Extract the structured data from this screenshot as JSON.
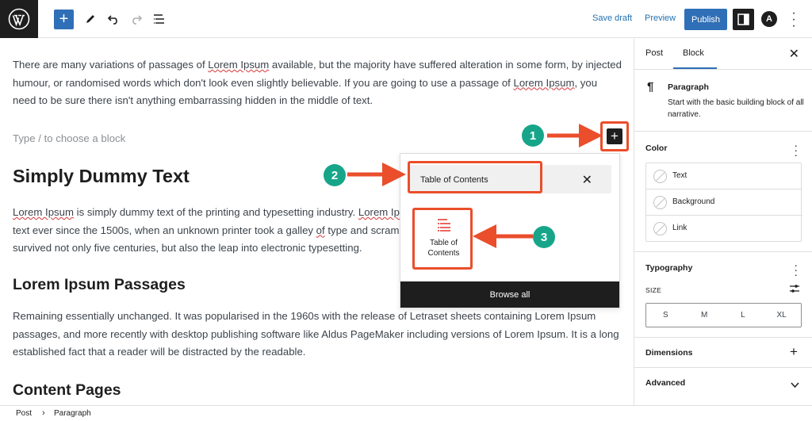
{
  "toolbar": {
    "save_draft": "Save draft",
    "preview": "Preview",
    "publish": "Publish",
    "astra_letter": "A"
  },
  "content": {
    "para1_parts": [
      "There are many variations of passages of ",
      "Lorem Ipsum",
      " available, but the majority have suffered alteration in some form, by injected humour, or randomised words which don't look even slightly believable. If you are going to use a passage of ",
      "Lorem Ipsum",
      ", you need to be sure there isn't anything embarrassing hidden in the middle of text."
    ],
    "placeholder": "Type / to choose a block",
    "heading1": "Simply Dummy Text",
    "para2_parts": [
      "Lorem Ipsum",
      " is simply dummy text of the printing and typesetting industry. ",
      "Lorem Ip",
      "...",
      "text ever since the 1500s, when an unknown printer took a galley ",
      "of",
      " type and scramb",
      "survived not only five centuries, but also the leap into electronic typesetting."
    ],
    "heading2": "Lorem Ipsum Passages",
    "para3": "Remaining essentially unchanged. It was popularised in the 1960s with the release of Letraset sheets containing Lorem Ipsum passages, and more recently with desktop publishing software like Aldus PageMaker including versions of Lorem Ipsum. It is a long established fact that a reader will be distracted by the readable.",
    "heading3": "Content Pages"
  },
  "inserter": {
    "search_value": "Table of Contents",
    "result_label_line1": "Table of",
    "result_label_line2": "Contents",
    "browse_all": "Browse all"
  },
  "annotations": {
    "badge1": "1",
    "badge2": "2",
    "badge3": "3",
    "color": "#ea4e2b",
    "badge_color": "#17a58a"
  },
  "sidebar": {
    "tab_post": "Post",
    "tab_block": "Block",
    "block_name": "Paragraph",
    "block_desc": "Start with the basic building block of all narrative.",
    "color_title": "Color",
    "color_items": [
      "Text",
      "Background",
      "Link"
    ],
    "typography_title": "Typography",
    "size_label": "SIZE",
    "sizes": [
      "S",
      "M",
      "L",
      "XL"
    ],
    "dimensions_title": "Dimensions",
    "advanced_title": "Advanced"
  },
  "breadcrumb": {
    "items": [
      "Post",
      "Paragraph"
    ]
  }
}
